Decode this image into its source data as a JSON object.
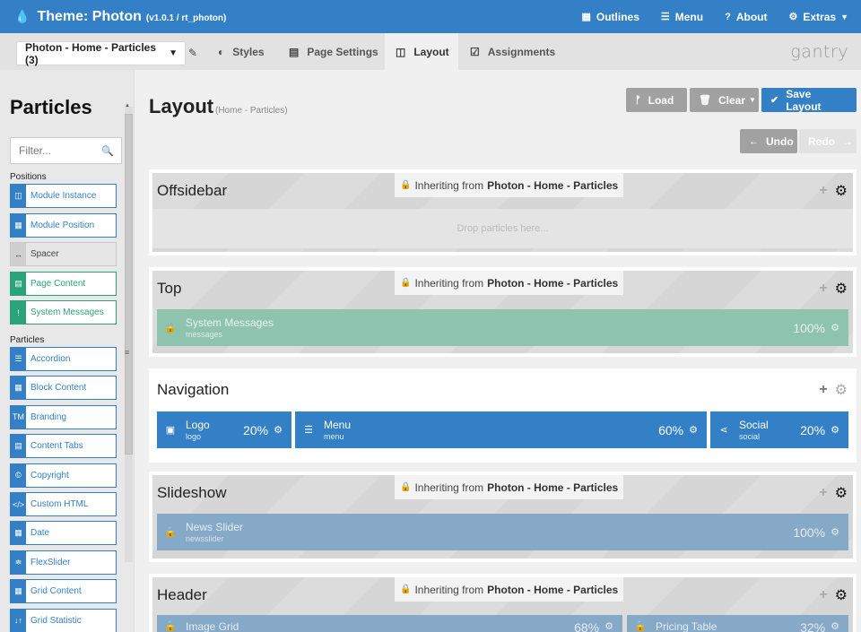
{
  "topbar": {
    "theme_label": "Theme: Photon",
    "theme_version": "(v1.0.1 / rt_photon)",
    "nav": [
      {
        "icon": "grid-icon",
        "label": "Outlines"
      },
      {
        "icon": "hamburger-icon",
        "label": "Menu"
      },
      {
        "icon": "question-icon",
        "label": "About"
      },
      {
        "icon": "gear-icon",
        "label": "Extras"
      }
    ]
  },
  "navbar": {
    "outline_selected": "Photon - Home - Particles (3)",
    "tabs": [
      {
        "label": "Styles"
      },
      {
        "label": "Page Settings"
      },
      {
        "label": "Layout"
      },
      {
        "label": "Assignments"
      }
    ],
    "brand": "gantry"
  },
  "sidebar": {
    "title": "Particles",
    "filter_placeholder": "Filter...",
    "positions_label": "Positions",
    "positions": [
      {
        "label": "Module Instance",
        "style": "blue",
        "icon": "◫"
      },
      {
        "label": "Module Position",
        "style": "blue",
        "icon": "▦"
      },
      {
        "label": "Spacer",
        "style": "gray",
        "icon": "↔"
      },
      {
        "label": "Page Content",
        "style": "green",
        "icon": "▤"
      },
      {
        "label": "System Messages",
        "style": "green",
        "icon": "!"
      }
    ],
    "particles_label": "Particles",
    "particles": [
      {
        "label": "Accordion",
        "icon": "☰"
      },
      {
        "label": "Block Content",
        "icon": "▦"
      },
      {
        "label": "Branding",
        "icon": "TM"
      },
      {
        "label": "Content Tabs",
        "icon": "▤"
      },
      {
        "label": "Copyright",
        "icon": "©"
      },
      {
        "label": "Custom HTML",
        "icon": "</>"
      },
      {
        "label": "Date",
        "icon": "▦"
      },
      {
        "label": "FlexSlider",
        "icon": "≑"
      },
      {
        "label": "Grid Content",
        "icon": "▦"
      },
      {
        "label": "Grid Statistic",
        "icon": "↓↑"
      }
    ]
  },
  "main": {
    "title": "Layout",
    "subtitle": "(Home - Particles)",
    "buttons": {
      "load": "Load",
      "clear": "Clear",
      "save": "Save Layout",
      "undo": "Undo",
      "redo": "Redo"
    },
    "inherit_prefix": "Inheriting from",
    "inherit_source": "Photon - Home - Particles",
    "drop_text": "Drop particles here...",
    "sections": [
      {
        "title": "Offsidebar"
      },
      {
        "title": "Top",
        "blocks": [
          {
            "name": "System Messages",
            "type": "messages",
            "pct": "100%"
          }
        ]
      },
      {
        "title": "Navigation",
        "blocks": [
          {
            "name": "Logo",
            "type": "logo",
            "pct": "20%"
          },
          {
            "name": "Menu",
            "type": "menu",
            "pct": "60%"
          },
          {
            "name": "Social",
            "type": "social",
            "pct": "20%"
          }
        ]
      },
      {
        "title": "Slideshow",
        "blocks": [
          {
            "name": "News Slider",
            "type": "newsslider",
            "pct": "100%"
          }
        ]
      },
      {
        "title": "Header",
        "blocks": [
          {
            "name": "Image Grid",
            "type": "",
            "pct": "68%"
          },
          {
            "name": "Pricing Table",
            "type": "",
            "pct": "32%"
          }
        ]
      }
    ]
  },
  "colors": {
    "brand_blue": "#3480c6",
    "green": "#2aa27a",
    "gray_button": "#a1a1a1"
  }
}
